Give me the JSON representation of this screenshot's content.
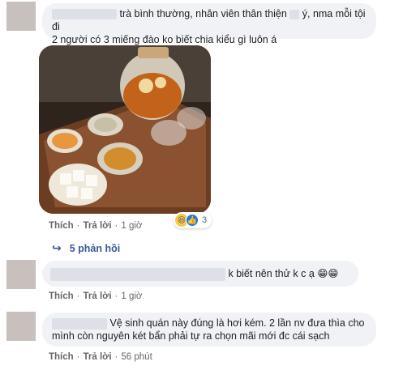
{
  "comments": [
    {
      "text": "trà bình thường, nhân viên thân thiện",
      "text_after": "ý, nma mỗi tội đi",
      "text_line2": "2 người có 3 miếng đào ko biết chia kiểu gì luôn á",
      "actions": {
        "like": "Thích",
        "reply": "Trả lời",
        "time": "1 giờ"
      },
      "reactions": {
        "icons": [
          "haha-icon",
          "like-icon"
        ],
        "count": "3"
      },
      "replies_label": "5 phản hồi"
    },
    {
      "text": "k biết nên thử k c ạ",
      "emoji": "😁😁",
      "actions": {
        "like": "Thích",
        "reply": "Trả lời",
        "time": "1 giờ"
      }
    },
    {
      "text": "Vệ sinh quán này đúng là hơi kém. 2 lần nv đưa thìa cho",
      "text_line2": "mình còn nguyên két bẩn phải tự ra chọn mãi mới đc cái sạch",
      "actions": {
        "like": "Thích",
        "reply": "Trả lời",
        "time": "56 phút"
      }
    }
  ],
  "colors": {
    "bubble": "#f0f2f5",
    "link": "#385898",
    "meta": "#65676b"
  }
}
